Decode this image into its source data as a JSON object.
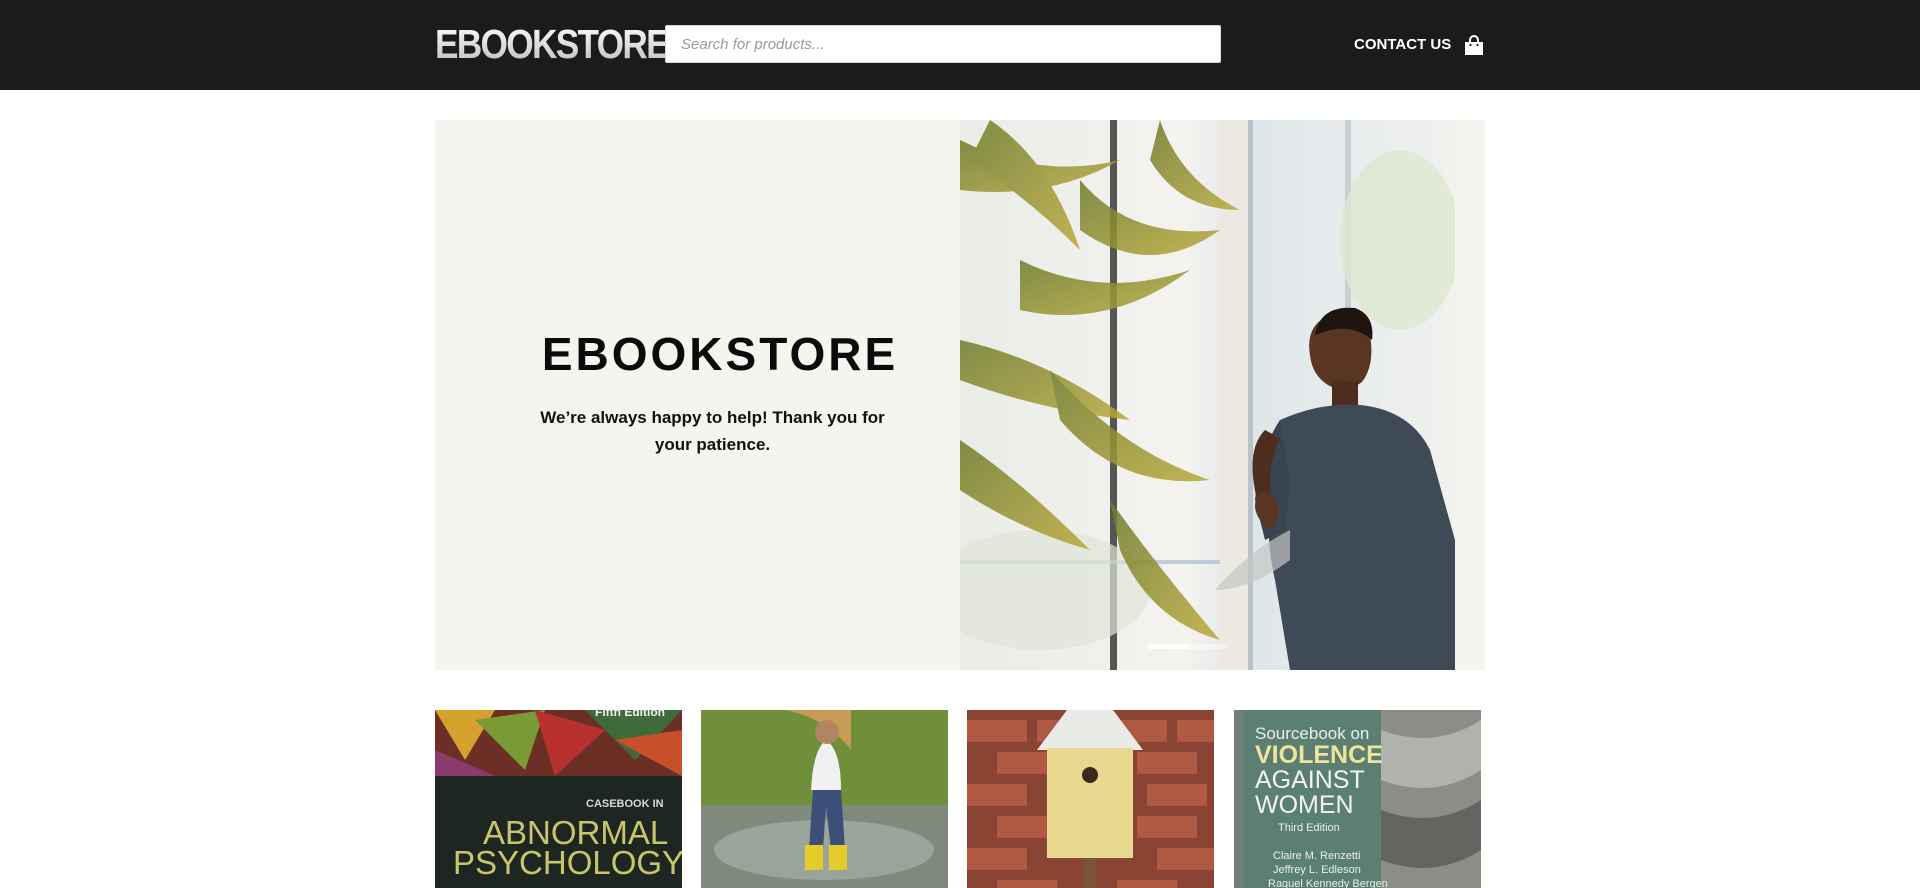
{
  "header": {
    "logo_text": "EBOOKSTORE",
    "search_placeholder": "Search for products...",
    "contact_label": "CONTACT US",
    "cart_icon": "shopping-bag-icon"
  },
  "hero": {
    "title": "EBOOKSTORE",
    "text": "We’re always happy to help! Thank you for your patience.",
    "slides_count": 3,
    "active_slide": 1
  },
  "products": [
    {
      "cover_edition": "Fifth Edition",
      "cover_kicker": "CASEBOOK IN",
      "cover_line1": "ABNORMAL",
      "cover_line2": "PSYCHOLOGY"
    },
    {},
    {},
    {
      "cover_kicker": "Sourcebook on",
      "cover_line1": "VIOLENCE",
      "cover_line2": "AGAINST",
      "cover_line3": "WOMEN",
      "cover_edition": "Third Edition",
      "cover_author1": "Claire M. Renzetti",
      "cover_author2": "Jeffrey L. Edleson",
      "cover_author3": "Raquel Kennedy Bergen"
    }
  ],
  "colors": {
    "header_bg": "#1b1b1b",
    "hero_bg": "#f5f4ee",
    "text_dark": "#0b0b0b",
    "white": "#ffffff"
  }
}
